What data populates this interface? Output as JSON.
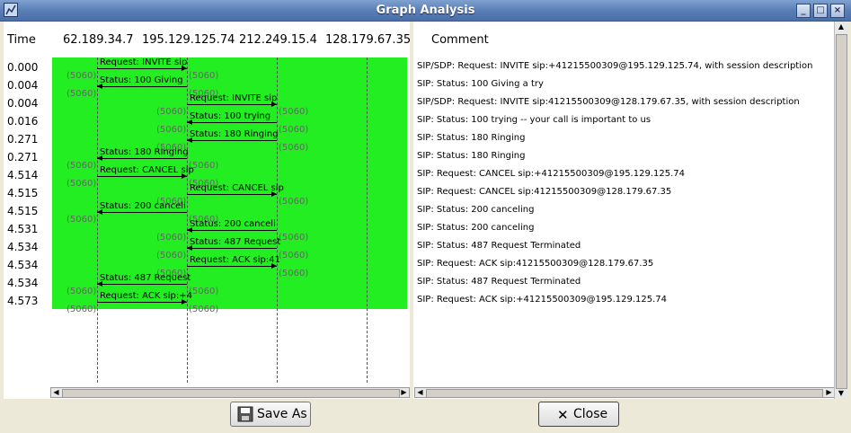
{
  "window": {
    "title": "Graph Analysis"
  },
  "header": {
    "time_label": "Time",
    "nodes": [
      "62.189.34.7",
      "195.129.125.74",
      "212.249.15.4",
      "128.179.67.35"
    ],
    "comment_label": "Comment"
  },
  "times": [
    "0.000",
    "0.004",
    "0.004",
    "0.016",
    "0.271",
    "0.271",
    "4.514",
    "4.515",
    "4.515",
    "4.531",
    "4.534",
    "4.534",
    "4.534",
    "4.573"
  ],
  "port_label": "(5060)",
  "messages": [
    {
      "label": "Request: INVITE sip",
      "dir": "right",
      "pair": 1
    },
    {
      "label": "Status: 100 Giving",
      "dir": "left",
      "pair": 1
    },
    {
      "label": "Request: INVITE sip",
      "dir": "right",
      "pair": 2
    },
    {
      "label": "Status: 100 trying",
      "dir": "left",
      "pair": 2
    },
    {
      "label": "Status: 180 Ringing",
      "dir": "left",
      "pair": 2
    },
    {
      "label": "Status: 180 Ringing",
      "dir": "left",
      "pair": 1
    },
    {
      "label": "Request: CANCEL sip",
      "dir": "right",
      "pair": 1
    },
    {
      "label": "Request: CANCEL sip",
      "dir": "right",
      "pair": 2
    },
    {
      "label": "Status: 200 canceli",
      "dir": "left",
      "pair": 1
    },
    {
      "label": "Status: 200 canceli",
      "dir": "left",
      "pair": 2
    },
    {
      "label": "Status: 487 Request",
      "dir": "left",
      "pair": 2
    },
    {
      "label": "Request: ACK sip:41",
      "dir": "right",
      "pair": 2
    },
    {
      "label": "Status: 487 Request",
      "dir": "left",
      "pair": 1
    },
    {
      "label": "Request: ACK sip:+4",
      "dir": "right",
      "pair": 1
    }
  ],
  "comments": [
    "SIP/SDP: Request: INVITE sip:+41215500309@195.129.125.74, with session description",
    "SIP: Status: 100 Giving a try",
    "SIP/SDP: Request: INVITE sip:41215500309@128.179.67.35, with session description",
    "SIP: Status: 100 trying -- your call is important to us",
    "SIP: Status: 180 Ringing",
    "SIP: Status: 180 Ringing",
    "SIP: Request: CANCEL sip:+41215500309@195.129.125.74",
    "SIP: Request: CANCEL sip:41215500309@128.179.67.35",
    "SIP: Status: 200 canceling",
    "SIP: Status: 200 canceling",
    "SIP: Status: 487 Request Terminated",
    "SIP: Request: ACK sip:41215500309@128.179.67.35",
    "SIP: Status: 487 Request Terminated",
    "SIP: Request: ACK sip:+41215500309@195.129.125.74"
  ],
  "buttons": {
    "save_as": "Save As",
    "close": "Close"
  },
  "colors": {
    "graph_background": "#22ee22",
    "title_bar": "#5a7fb8"
  },
  "icons": {
    "save": "floppy-disk-icon",
    "close": "x-icon"
  }
}
